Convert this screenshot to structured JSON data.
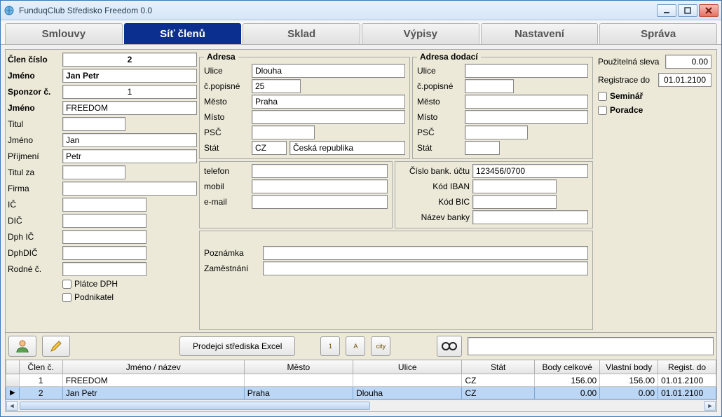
{
  "window": {
    "title": "FunduqClub Středisko Freedom 0.0"
  },
  "tabs": [
    "Smlouvy",
    "Síť členů",
    "Sklad",
    "Výpisy",
    "Nastavení",
    "Správa"
  ],
  "activeTab": 1,
  "left": {
    "labels": {
      "memberNo": "Člen číslo",
      "name1": "Jméno",
      "sponsorNo": "Sponzor č.",
      "name2": "Jméno",
      "title": "Titul",
      "firstName": "Jméno",
      "lastName": "Příjmení",
      "titleAfter": "Titul za",
      "company": "Firma",
      "ic": "IČ",
      "dic": "DIČ",
      "dphIc": "Dph IČ",
      "dphDic": "DphDIČ",
      "birthNo": "Rodné č."
    },
    "values": {
      "memberNo": "2",
      "name1": "Jan Petr",
      "sponsorNo": "1",
      "name2": "FREEDOM",
      "title": "",
      "firstName": "Jan",
      "lastName": "Petr",
      "titleAfter": "",
      "company": "",
      "ic": "",
      "dic": "",
      "dphIc": "",
      "dphDic": "",
      "birthNo": ""
    },
    "checks": {
      "vatPayer": "Plátce DPH",
      "entrepreneur": "Podnikatel"
    }
  },
  "address": {
    "legend": "Adresa",
    "labels": {
      "street": "Ulice",
      "houseNo": "č.popisné",
      "city": "Město",
      "place": "Místo",
      "zip": "PSČ",
      "country": "Stát"
    },
    "values": {
      "street": "Dlouha",
      "houseNo": "25",
      "city": "Praha",
      "place": "",
      "zip": "",
      "countryCode": "CZ",
      "countryName": "Česká republika"
    }
  },
  "shipAddress": {
    "legend": "Adresa dodací",
    "values": {
      "street": "",
      "houseNo": "",
      "city": "",
      "place": "",
      "zip": "",
      "countryCode": ""
    }
  },
  "contact": {
    "labels": {
      "phone": "telefon",
      "mobile": "mobil",
      "email": "e-mail"
    },
    "values": {
      "phone": "",
      "mobile": "",
      "email": ""
    }
  },
  "bank": {
    "labels": {
      "acct": "Číslo bank. účtu",
      "iban": "Kód IBAN",
      "bic": "Kód BIC",
      "bankName": "Název banky"
    },
    "values": {
      "acct": "123456/0700",
      "iban": "",
      "bic": "",
      "bankName": ""
    }
  },
  "notes": {
    "labels": {
      "note": "Poznámka",
      "job": "Zaměstnání"
    },
    "values": {
      "note": "",
      "job": ""
    }
  },
  "right": {
    "labels": {
      "discount": "Použitelná sleva",
      "regUntil": "Registrace do",
      "seminar": "Seminář",
      "advisor": "Poradce"
    },
    "values": {
      "discount": "0.00",
      "regUntil": "01.01.2100"
    }
  },
  "toolbar": {
    "excelBtn": "Prodejci střediska Excel",
    "smallBtns": [
      "1",
      "A",
      "city"
    ]
  },
  "grid": {
    "columns": [
      "Člen č.",
      "Jméno / název",
      "Město",
      "Ulice",
      "Stát",
      "Body celkové",
      "Vlastní body",
      "Regist. do"
    ],
    "rows": [
      {
        "memberNo": "1",
        "name": "FREEDOM",
        "city": "",
        "street": "",
        "country": "CZ",
        "totalPts": "156.00",
        "ownPts": "156.00",
        "regUntil": "01.01.2100",
        "selected": false
      },
      {
        "memberNo": "2",
        "name": "Jan  Petr",
        "city": "Praha",
        "street": "Dlouha",
        "country": "CZ",
        "totalPts": "0.00",
        "ownPts": "0.00",
        "regUntil": "01.01.2100",
        "selected": true
      }
    ]
  }
}
